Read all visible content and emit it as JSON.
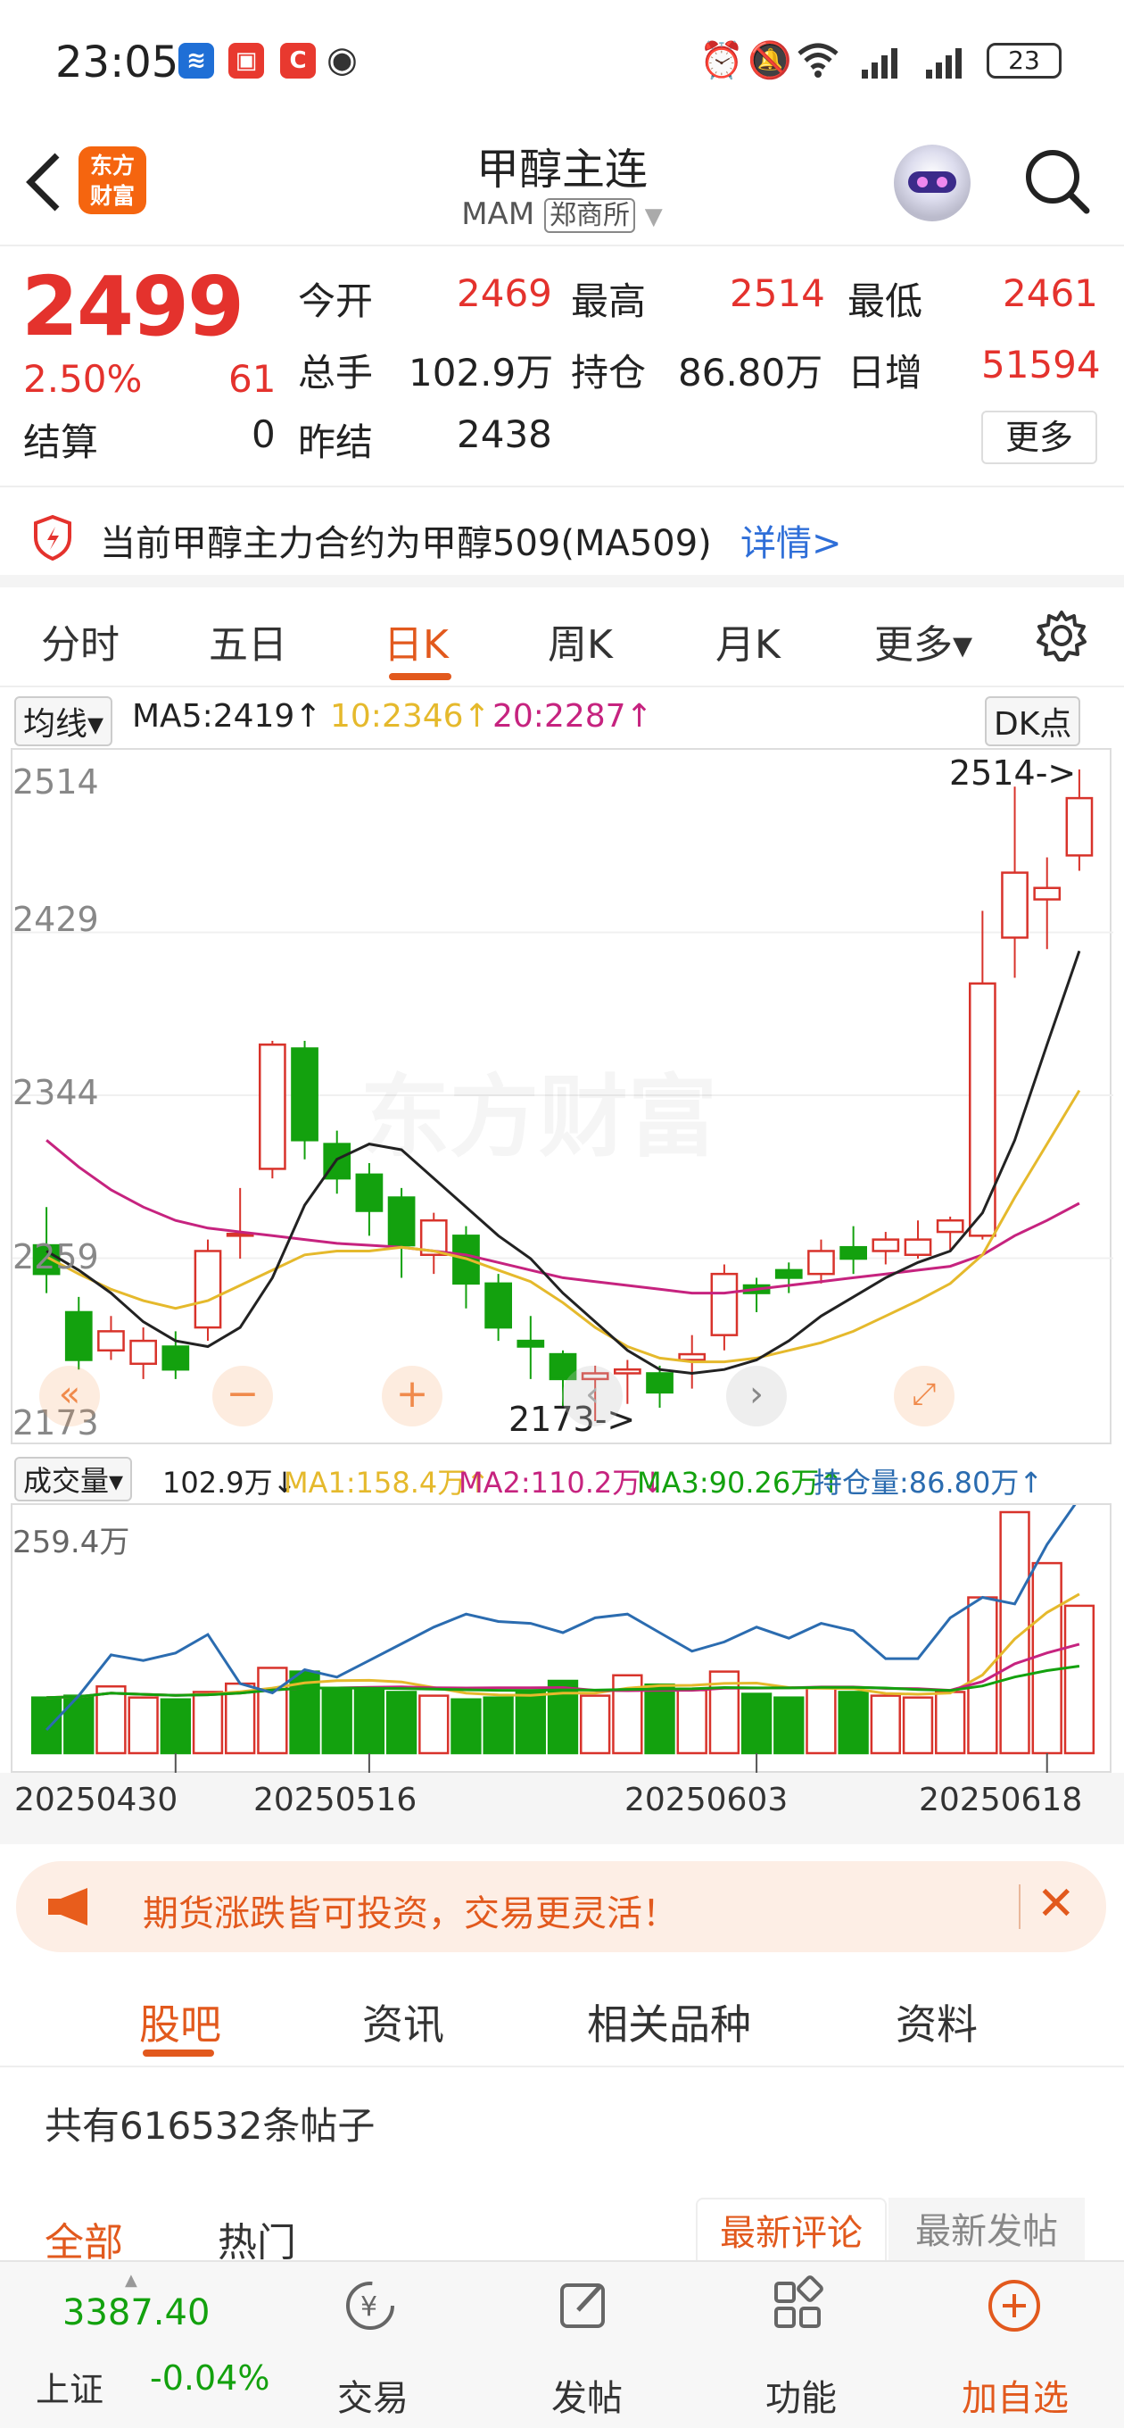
{
  "status": {
    "time": "23:05",
    "battery": "23"
  },
  "header": {
    "back_icon": "chevron-left-icon",
    "brand_logo": "东方\n财富",
    "title": "甲醇主连",
    "subtitle_code": "MAM",
    "exchange": "郑商所",
    "search_icon": "search-icon"
  },
  "quote": {
    "price": "2499",
    "change_pct": "2.50%",
    "change_abs": "61",
    "today_open_label": "今开",
    "today_open": "2469",
    "high_label": "最高",
    "high": "2514",
    "low_label": "最低",
    "low": "2461",
    "volume_label": "总手",
    "volume": "102.9万",
    "open_interest_label": "持仓",
    "open_interest": "86.80万",
    "daily_inc_label": "日增",
    "daily_inc": "51594",
    "settle_label": "结算",
    "settle": "0",
    "prev_settle_label": "昨结",
    "prev_settle": "2438",
    "more_label": "更多"
  },
  "notice": {
    "text": "当前甲醇主力合约为甲醇509(MA509)",
    "link": "详情>"
  },
  "tabs": [
    "分时",
    "五日",
    "日K",
    "周K",
    "月K",
    "更多▾"
  ],
  "ma": {
    "selector": "均线▾",
    "ma5": "MA5:2419↑",
    "ma10": "10:2346↑",
    "ma20": "20:2287↑",
    "dk": "DK点"
  },
  "kchart": {
    "y_labels": [
      "2514",
      "2429",
      "2344",
      "2259",
      "2173"
    ],
    "high_marker": "2514->",
    "low_marker": "2173->",
    "watermark": "东方财富"
  },
  "vol": {
    "selector": "成交量▾",
    "vol": "102.9万↓",
    "ma1": "MA1:158.4万↑",
    "ma2": "MA2:110.2万↓",
    "ma3": "MA3:90.26万↑",
    "oi": "持仓量:86.80万↑",
    "max_label": "259.4万"
  },
  "dates": [
    "20250430",
    "20250516",
    "20250603",
    "20250618"
  ],
  "banner": {
    "text": "期货涨跌皆可投资，交易更灵活！"
  },
  "board_tabs": [
    "股吧",
    "资讯",
    "相关品种",
    "资料"
  ],
  "posts": {
    "count_text": "共有616532条帖子"
  },
  "filters": {
    "all": "全部",
    "hot": "热门",
    "latest_comment": "最新评论",
    "latest_post": "最新发帖"
  },
  "bottom": {
    "index_value": "3387.40",
    "index_name": "上证",
    "index_change": "-0.04%",
    "trade": "交易",
    "post": "发帖",
    "func": "功能",
    "add": "加自选"
  },
  "chart_data": {
    "type": "candlestick",
    "ylim": [
      2173,
      2514
    ],
    "candles": [
      [
        2265,
        2250,
        2285,
        2240
      ],
      [
        2230,
        2205,
        2238,
        2200
      ],
      [
        2210,
        2220,
        2228,
        2205
      ],
      [
        2203,
        2215,
        2222,
        2195
      ],
      [
        2212,
        2200,
        2220,
        2195
      ],
      [
        2222,
        2262,
        2268,
        2215
      ],
      [
        2270,
        2271,
        2295,
        2258
      ],
      [
        2305,
        2370,
        2372,
        2300
      ],
      [
        2368,
        2320,
        2372,
        2310
      ],
      [
        2318,
        2300,
        2325,
        2292
      ],
      [
        2302,
        2283,
        2308,
        2270
      ],
      [
        2290,
        2265,
        2295,
        2248
      ],
      [
        2260,
        2278,
        2282,
        2250
      ],
      [
        2270,
        2245,
        2275,
        2232
      ],
      [
        2245,
        2222,
        2250,
        2215
      ],
      [
        2215,
        2212,
        2228,
        2195
      ],
      [
        2208,
        2195,
        2210,
        2180
      ],
      [
        2195,
        2198,
        2202,
        2173
      ],
      [
        2198,
        2200,
        2205,
        2182
      ],
      [
        2198,
        2188,
        2202,
        2180
      ],
      [
        2205,
        2208,
        2218,
        2190
      ],
      [
        2218,
        2250,
        2255,
        2210
      ],
      [
        2244,
        2240,
        2248,
        2230
      ],
      [
        2252,
        2248,
        2256,
        2240
      ],
      [
        2250,
        2262,
        2268,
        2245
      ],
      [
        2264,
        2258,
        2275,
        2250
      ],
      [
        2262,
        2268,
        2272,
        2255
      ],
      [
        2260,
        2268,
        2278,
        2258
      ],
      [
        2272,
        2278,
        2280,
        2262
      ],
      [
        2270,
        2402,
        2440,
        2268
      ],
      [
        2426,
        2460,
        2505,
        2405
      ],
      [
        2446,
        2452,
        2468,
        2420
      ],
      [
        2469,
        2499,
        2514,
        2461
      ]
    ],
    "ma5": [
      2262,
      2252,
      2240,
      2225,
      2215,
      2212,
      2222,
      2248,
      2286,
      2310,
      2318,
      2315,
      2300,
      2285,
      2270,
      2258,
      2240,
      2225,
      2210,
      2200,
      2198,
      2200,
      2205,
      2215,
      2228,
      2238,
      2248,
      2256,
      2262,
      2282,
      2320,
      2370,
      2419
    ],
    "ma10": [
      2259,
      2250,
      2242,
      2236,
      2232,
      2236,
      2244,
      2252,
      2260,
      2262,
      2262,
      2264,
      2262,
      2258,
      2252,
      2246,
      2235,
      2222,
      2212,
      2206,
      2204,
      2204,
      2206,
      2210,
      2214,
      2220,
      2228,
      2236,
      2245,
      2260,
      2290,
      2318,
      2346
    ],
    "ma20": [
      2320,
      2306,
      2294,
      2285,
      2278,
      2274,
      2272,
      2270,
      2268,
      2266,
      2265,
      2264,
      2262,
      2260,
      2256,
      2252,
      2248,
      2246,
      2244,
      2242,
      2240,
      2240,
      2242,
      2244,
      2246,
      2248,
      2250,
      2252,
      2254,
      2260,
      2270,
      2278,
      2287
    ],
    "volume": [
      60,
      62,
      72,
      60,
      58,
      66,
      75,
      92,
      88,
      70,
      68,
      66,
      62,
      58,
      60,
      66,
      78,
      62,
      84,
      74,
      68,
      88,
      64,
      60,
      70,
      66,
      62,
      60,
      66,
      168,
      260,
      205,
      159
    ],
    "open_interest": [
      25,
      62,
      106,
      100,
      108,
      128,
      75,
      65,
      90,
      82,
      100,
      118,
      136,
      150,
      142,
      140,
      130,
      146,
      150,
      130,
      110,
      120,
      136,
      124,
      140,
      132,
      102,
      102,
      146,
      168,
      161,
      225,
      275
    ]
  }
}
